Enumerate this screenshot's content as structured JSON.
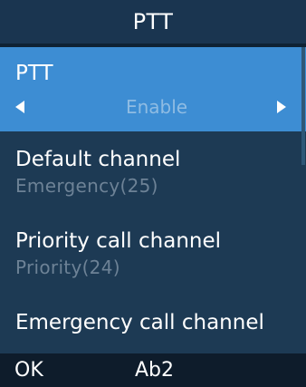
{
  "header": {
    "title": "PTT"
  },
  "settings": {
    "items": [
      {
        "label": "PTT",
        "value": "Enable",
        "selected": true,
        "left_arrow_icon": "triangle-left-icon",
        "right_arrow_icon": "triangle-right-icon"
      },
      {
        "label": "Default channel",
        "value": "Emergency(25)"
      },
      {
        "label": "Priority call channel",
        "value": "Priority(24)"
      },
      {
        "label": "Emergency call channel"
      }
    ]
  },
  "softkeys": {
    "left": "OK",
    "middle": "Ab2"
  },
  "colors": {
    "background": "#1d3a54",
    "selected": "#3d8dd3",
    "value_text": "#6d8296",
    "softkey_bar": "#0e1c2b"
  }
}
